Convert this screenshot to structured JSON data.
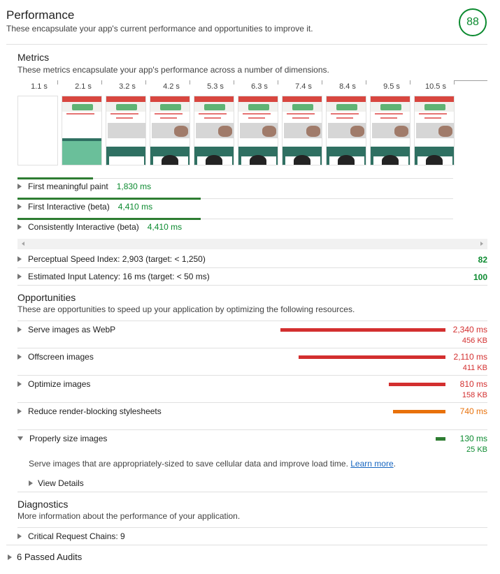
{
  "header": {
    "title": "Performance",
    "subtitle": "These encapsulate your app's current performance and opportunities to improve it.",
    "score": "88"
  },
  "metrics": {
    "title": "Metrics",
    "subtitle": "These metrics encapsulate your app's performance across a number of dimensions.",
    "filmstrip_ticks": [
      "1.1 s",
      "2.1 s",
      "3.2 s",
      "4.2 s",
      "5.3 s",
      "6.3 s",
      "7.4 s",
      "8.4 s",
      "9.5 s",
      "10.5 s"
    ],
    "items": [
      {
        "label": "First meaningful paint",
        "value": "1,830 ms"
      },
      {
        "label": "First Interactive (beta)",
        "value": "4,410 ms"
      },
      {
        "label": "Consistently Interactive (beta)",
        "value": "4,410 ms"
      }
    ],
    "scored": [
      {
        "label": "Perceptual Speed Index: 2,903 (target: < 1,250)",
        "score": "82"
      },
      {
        "label": "Estimated Input Latency: 16 ms (target: < 50 ms)",
        "score": "100"
      }
    ]
  },
  "opportunities": {
    "title": "Opportunities",
    "subtitle": "These are opportunities to speed up your application by optimizing the following resources.",
    "items": [
      {
        "label": "Serve images as WebP",
        "ms": "2,340 ms",
        "kb": "456 KB",
        "bar_fraction": 0.82,
        "color": "#d32f2f"
      },
      {
        "label": "Offscreen images",
        "ms": "2,110 ms",
        "kb": "411 KB",
        "bar_fraction": 0.73,
        "color": "#d32f2f"
      },
      {
        "label": "Optimize images",
        "ms": "810 ms",
        "kb": "158 KB",
        "bar_fraction": 0.28,
        "color": "#d32f2f"
      },
      {
        "label": "Reduce render-blocking stylesheets",
        "ms": "740 ms",
        "kb": "",
        "bar_fraction": 0.26,
        "color": "#e8710a"
      },
      {
        "label": "Properly size images",
        "ms": "130 ms",
        "kb": "25 KB",
        "bar_fraction": 0.05,
        "color": "#2e7d32"
      }
    ],
    "expanded_description": "Serve images that are appropriately-sized to save cellular data and improve load time.",
    "learn_more": "Learn more",
    "view_details": "View Details"
  },
  "diagnostics": {
    "title": "Diagnostics",
    "subtitle": "More information about the performance of your application.",
    "items": [
      {
        "label": "Critical Request Chains: 9"
      }
    ]
  },
  "passed": {
    "label": "6 Passed Audits"
  },
  "colors": {
    "pass": "#0b8a2f",
    "fail": "#d32f2f",
    "average": "#e8710a"
  }
}
